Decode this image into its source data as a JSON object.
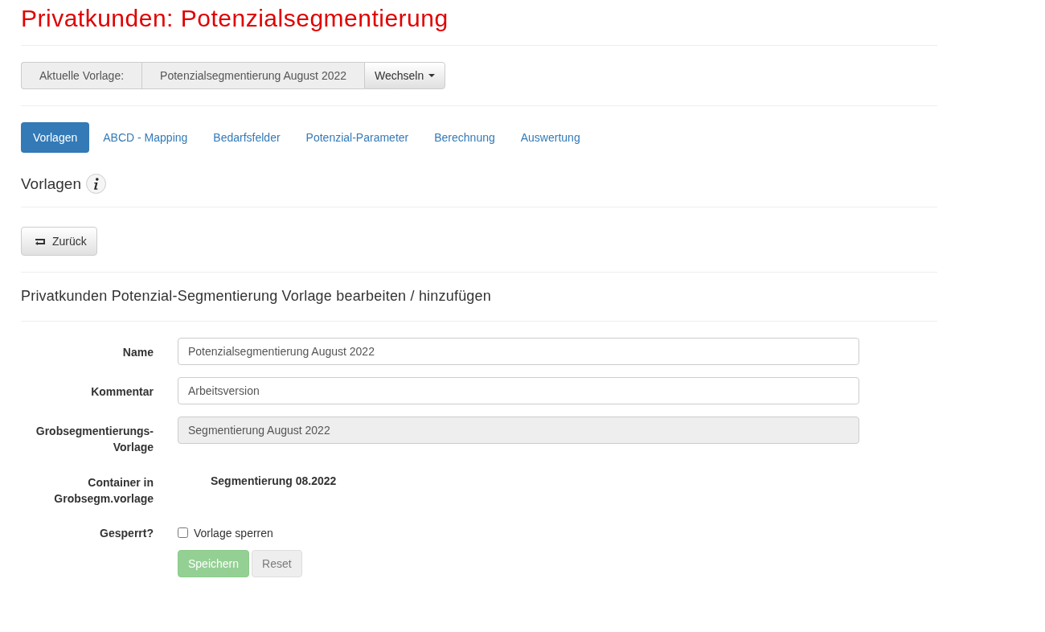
{
  "page_title": "Privatkunden: Potenzialsegmentierung",
  "template_bar": {
    "label": "Aktuelle Vorlage:",
    "value": "Potenzialsegmentierung August 2022",
    "button": "Wechseln"
  },
  "tabs": [
    {
      "label": "Vorlagen",
      "selected": true
    },
    {
      "label": "ABCD - Mapping",
      "selected": false
    },
    {
      "label": "Bedarfsfelder",
      "selected": false
    },
    {
      "label": "Potenzial-Parameter",
      "selected": false
    },
    {
      "label": "Berechnung",
      "selected": false
    },
    {
      "label": "Auswertung",
      "selected": false
    }
  ],
  "section_title": "Vorlagen",
  "back_button": "Zurück",
  "form_title": "Privatkunden Potenzial-Segmentierung Vorlage bearbeiten / hinzufügen",
  "fields": [
    {
      "kind": "input",
      "label": "Name",
      "value": "Potenzialsegmentierung August 2022",
      "disabled": false
    },
    {
      "kind": "input",
      "label": "Kommentar",
      "value": "Arbeitsversion",
      "disabled": false
    },
    {
      "kind": "input",
      "label": "Grobsegmentierungs-Vorlage",
      "value": "Segmentierung August 2022",
      "disabled": true
    },
    {
      "kind": "static",
      "label": "Container in Grobsegm.vorlage",
      "value": "Segmentierung 08.2022"
    },
    {
      "kind": "checkbox",
      "label": "Gesperrt?",
      "value": "Vorlage sperren",
      "checked": false
    }
  ],
  "actions": [
    {
      "kind": "primary",
      "label": "Speichern",
      "disabled": true
    },
    {
      "kind": "default",
      "label": "Reset",
      "disabled": true
    }
  ]
}
